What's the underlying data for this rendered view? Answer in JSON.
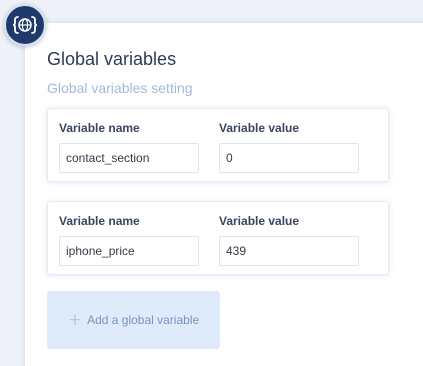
{
  "page": {
    "title": "Global variables",
    "subtitle": "Global variables setting"
  },
  "variables": [
    {
      "name_label": "Variable name",
      "value_label": "Variable value",
      "name": "contact_section",
      "value": "0"
    },
    {
      "name_label": "Variable name",
      "value_label": "Variable value",
      "name": "iphone_price",
      "value": "439"
    }
  ],
  "add_button": {
    "icon": "plus-icon",
    "label": "Add a global variable"
  },
  "logo": {
    "icon": "globe-braces-icon"
  },
  "colors": {
    "title": "#2e3a55",
    "subtitle": "#a3b9dc",
    "logo_bg": "#1f3a6a",
    "add_button_bg": "#dfeafb",
    "add_button_text": "#7b93bd"
  }
}
